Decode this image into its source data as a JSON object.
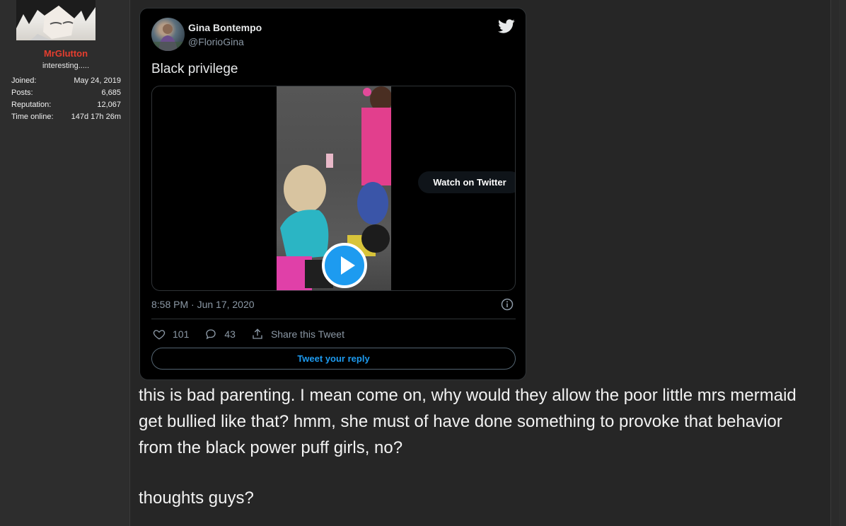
{
  "user": {
    "username": "MrGlutton",
    "title": "interesting.....",
    "stats": [
      {
        "label": "Joined:",
        "value": "May 24, 2019"
      },
      {
        "label": "Posts:",
        "value": "6,685"
      },
      {
        "label": "Reputation:",
        "value": "12,067"
      },
      {
        "label": "Time online:",
        "value": "147d 17h 26m"
      }
    ]
  },
  "tweet": {
    "name": "Gina Bontempo",
    "handle": "@FlorioGina",
    "text": "Black privilege",
    "watch_label": "Watch on Twitter",
    "timestamp": "8:58 PM · Jun 17, 2020",
    "likes": "101",
    "replies": "43",
    "share_label": "Share this Tweet",
    "reply_label": "Tweet your reply",
    "accent": "#1d9bf0"
  },
  "post": {
    "paragraph1": "this is bad parenting. I mean come on, why would they allow the poor little mrs mermaid get bullied like that? hmm, she must of have done something to provoke that behavior from the black power puff girls, no?",
    "paragraph2": "thoughts guys?"
  },
  "colors": {
    "username": "#e53e2f",
    "background": "#262626"
  }
}
